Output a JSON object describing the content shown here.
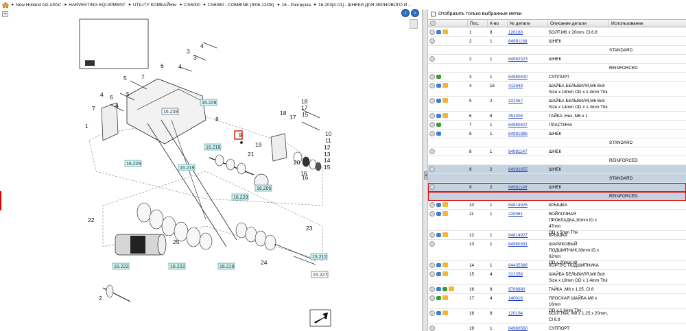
{
  "breadcrumb": [
    "New Holland AG APAC",
    "HARVESTING EQUIPMENT",
    "UTILITY КОМБАЙНЫ",
    "CS6000",
    "CS6080 - COMBINE (9/06-12/08)",
    "16 - Разгрузка",
    "16.203[A.01] - ШНЕКИ ДЛЯ ЗЕРНОВОГО И ..."
  ],
  "nav": {
    "back_icon": "left-arrow-circle-icon",
    "forward_icon": "right-arrow-circle-icon"
  },
  "filter": {
    "label": "Отобразить только выбранные метки"
  },
  "table": {
    "headers": {
      "pos": "Пос.",
      "qty": "К-во",
      "part": "№ детали",
      "desc": "Описание детали",
      "use": "Использование"
    },
    "rows": [
      {
        "pos": "1",
        "qty": "8",
        "part": "120160",
        "desc": [
          "БОЛТ,M6 x 20mm, Cl 8.8"
        ],
        "use": "",
        "icons": [
          "info",
          "eye",
          "cart"
        ]
      },
      {
        "pos": "2",
        "qty": "1",
        "part": "84981168",
        "desc": [
          "ШНЕК"
        ],
        "use": "",
        "sub": "STANDARD",
        "icons": [
          "info"
        ]
      },
      {
        "pos": "2",
        "qty": "1",
        "part": "84982323",
        "desc": [
          "ШНЕК"
        ],
        "use": "",
        "sub": "REINFORCED",
        "icons": [
          "info"
        ]
      },
      {
        "pos": "3",
        "qty": "1",
        "part": "84980400",
        "desc": [
          "СУППОРТ"
        ],
        "use": "",
        "icons": [
          "info",
          "green"
        ]
      },
      {
        "pos": "4",
        "qty": "16",
        "part": "412649",
        "desc": [
          "ШАЙБА БЕЛЬВИЛЯ,M6 Bolt",
          "Size x 18mm OD x 1.4mm Thk"
        ],
        "use": "",
        "icons": [
          "info",
          "eye",
          "cart"
        ]
      },
      {
        "pos": "5",
        "qty": "2",
        "part": "322357",
        "desc": [
          "ШАЙБА БЕЛЬВИЛЯ,M6 Bolt",
          "Size x 14mm OD x 1.3mm Thk"
        ],
        "use": "",
        "icons": [
          "info",
          "eye",
          "cart"
        ]
      },
      {
        "pos": "6",
        "qty": "8",
        "part": "353308",
        "desc": [
          "ГАЙКА ,Hex, M6 x 1"
        ],
        "use": "",
        "icons": [
          "info",
          "eye",
          "cart"
        ]
      },
      {
        "pos": "7",
        "qty": "1",
        "part": "84980407",
        "desc": [
          "ПЛАСТИНА"
        ],
        "use": "",
        "icons": [
          "info",
          "green"
        ]
      },
      {
        "pos": "8",
        "qty": "1",
        "part": "84981986",
        "desc": [
          "ШНЕК"
        ],
        "use": "",
        "sub": "STANDARD",
        "icons": [
          "info",
          "eye"
        ]
      },
      {
        "pos": "8",
        "qty": "1",
        "part": "84981147",
        "desc": [
          "ШНЕК"
        ],
        "use": "",
        "sub": "REINFORCED",
        "icons": [
          "info"
        ]
      },
      {
        "pos": "9",
        "qty": "2",
        "part": "84992855",
        "desc": [
          "ШНЕК"
        ],
        "use": "",
        "sub": "STANDARD",
        "icons": [
          "info"
        ],
        "state": "sel"
      },
      {
        "pos": "9",
        "qty": "2",
        "part": "84981148",
        "desc": [
          "ШНЕК"
        ],
        "use": "",
        "sub": "REINFORCED",
        "icons": [
          "info"
        ],
        "state": "hi"
      },
      {
        "pos": "10",
        "qty": "1",
        "part": "84814926",
        "desc": [
          "КРЫШКА"
        ],
        "use": "",
        "icons": [
          "info",
          "eye",
          "cart"
        ]
      },
      {
        "pos": "11",
        "qty": "1",
        "part": "220061",
        "desc": [
          "ВОЙЛОЧНАЯ",
          "ПРОКЛАДКА,30mm ID x 47mm",
          "OD x 5mm Thk"
        ],
        "use": "",
        "icons": [
          "info",
          "eye",
          "cart"
        ]
      },
      {
        "pos": "12",
        "qty": "1",
        "part": "84814927",
        "desc": [
          "КРЫШКА"
        ],
        "use": "",
        "icons": [
          "info",
          "eye",
          "cart"
        ]
      },
      {
        "pos": "13",
        "qty": "1",
        "part": "84980391",
        "desc": [
          "ШАРИКОВЫЙ",
          "ПОДШИПНИК,30mm ID x 62mm",
          "OD x 20mm W"
        ],
        "use": "",
        "icons": [
          "info"
        ]
      },
      {
        "pos": "14",
        "qty": "1",
        "part": "84435386",
        "desc": [
          "КОРПУС ПОДШИПНИКА"
        ],
        "use": "",
        "icons": [
          "info",
          "eye",
          "cart"
        ]
      },
      {
        "pos": "15",
        "qty": "4",
        "part": "322358",
        "desc": [
          "ШАЙБА БЕЛЬВИЛЯ,M8 Bolt",
          "Size x 18mm OD x 1.4mm Thk"
        ],
        "use": "",
        "icons": [
          "info",
          "eye",
          "cart"
        ]
      },
      {
        "pos": "16",
        "qty": "8",
        "part": "9706690",
        "desc": [
          "ГАЙКА ,M8 x 1.25, Cl 8"
        ],
        "use": "",
        "icons": [
          "info",
          "eye",
          "green",
          "cart"
        ]
      },
      {
        "pos": "17",
        "qty": "4",
        "part": "140016",
        "desc": [
          "ПЛОСКАЯ ШАЙБА,M8 x 16mm",
          "OD x 1.6mm Thk"
        ],
        "use": "",
        "icons": [
          "info",
          "green",
          "cart"
        ]
      },
      {
        "pos": "18",
        "qty": "8",
        "part": "120104",
        "desc": [
          "БОЛТ,Hex, M8 x 1.25 x 20mm,",
          "Cl 8.8"
        ],
        "use": "",
        "icons": [
          "info",
          "eye",
          "cart"
        ]
      },
      {
        "pos": "19",
        "qty": "1",
        "part": "84980560",
        "desc": [
          "СУППОРТ"
        ],
        "use": "",
        "icons": [
          "info"
        ]
      }
    ]
  },
  "diagram": {
    "callouts": [
      "1",
      "2",
      "3",
      "4",
      "5",
      "6",
      "7",
      "8",
      "9",
      "10",
      "11",
      "12",
      "13",
      "14",
      "15",
      "16",
      "17",
      "18",
      "19",
      "20",
      "21",
      "22",
      "23",
      "24",
      "25"
    ],
    "refs_teal": [
      "16.229",
      "16.218",
      "16.229",
      "16.219",
      "16.205",
      "16.229",
      "16.222",
      "16.222",
      "16.219",
      "15.212"
    ],
    "refs_white": [
      "16.208",
      "15.227"
    ]
  }
}
